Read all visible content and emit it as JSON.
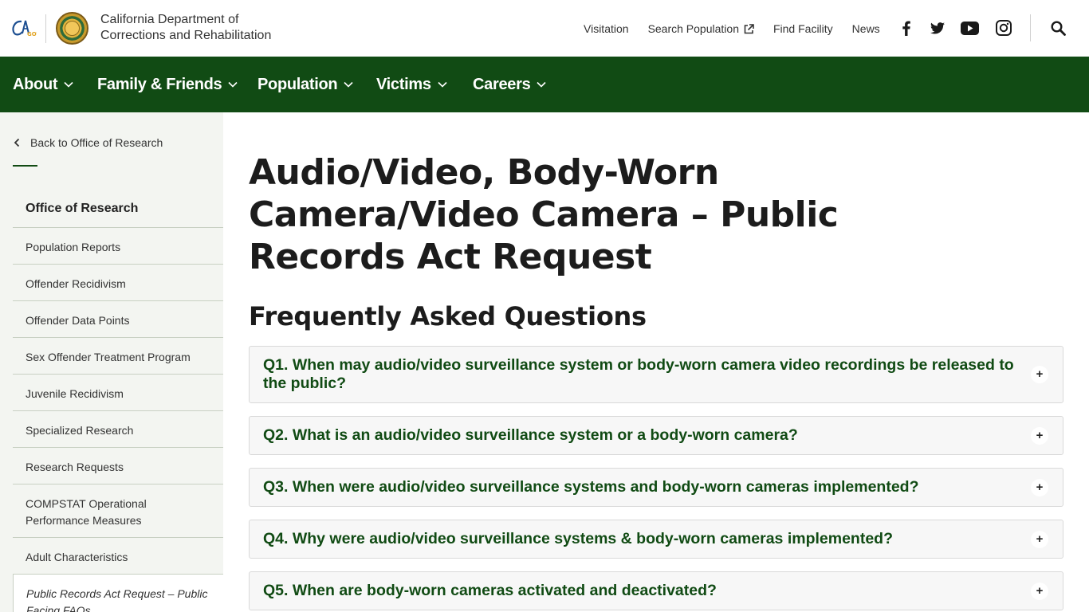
{
  "header": {
    "ca_logo_icon": "ca-gov-logo",
    "seal_icon": "cdcr-seal",
    "org_name_line1": "California Department of",
    "org_name_line2": "Corrections and Rehabilitation"
  },
  "topnav": {
    "visitation": "Visitation",
    "search_population": "Search Population",
    "find_facility": "Find Facility",
    "news": "News"
  },
  "mainnav": {
    "items": [
      "About",
      "Family & Friends",
      "Population",
      "Victims",
      "Careers"
    ]
  },
  "sidebar": {
    "back_link": "Back to Office of Research",
    "title": "Office of Research",
    "items": [
      "Population Reports",
      "Offender Recidivism",
      "Offender Data Points",
      "Sex Offender Treatment Program",
      "Juvenile Recidivism",
      "Specialized Research",
      "Research Requests",
      "COMPSTAT Operational Performance Measures",
      "Adult Characteristics"
    ],
    "active_item": "Public Records Act Request – Public Facing FAQs"
  },
  "content": {
    "title": "Audio/Video, Body-Worn Camera/Video Camera – Public Records Act Request",
    "faq_heading": "Frequently Asked Questions",
    "faqs": [
      "Q1. When may audio/video surveillance system or body-worn camera video recordings be released to the public?",
      "Q2. What is an audio/video surveillance system or a body-worn camera?",
      "Q3. When were audio/video surveillance systems and body-worn cameras implemented?",
      "Q4. Why were audio/video surveillance systems & body-worn cameras implemented?",
      "Q5. When are body-worn cameras activated and deactivated?"
    ],
    "expand_symbol": "+"
  },
  "colors": {
    "brand_green": "#114b14",
    "sidebar_bg": "#f3f5f1",
    "faq_bg": "#f7f7f7"
  }
}
